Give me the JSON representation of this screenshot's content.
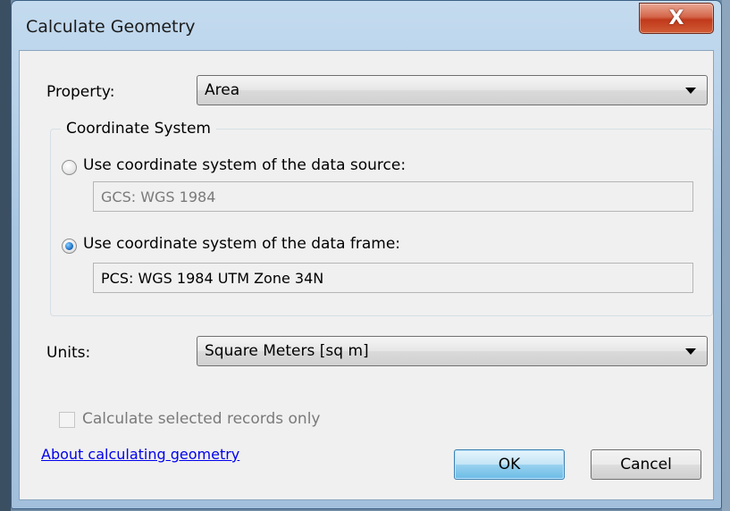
{
  "window": {
    "title": "Calculate Geometry",
    "close_glyph": "X"
  },
  "property": {
    "label": "Property:",
    "selected": "Area"
  },
  "coordinate_system": {
    "group_title": "Coordinate System",
    "source_option": {
      "label": "Use coordinate system of the data source:",
      "selected": false,
      "value": "GCS: WGS 1984"
    },
    "frame_option": {
      "label": "Use coordinate system of the data frame:",
      "selected": true,
      "value": "PCS: WGS 1984 UTM Zone 34N"
    }
  },
  "units": {
    "label": "Units:",
    "selected": "Square Meters [sq m]"
  },
  "selected_only": {
    "label": "Calculate selected records only",
    "checked": false,
    "enabled": false
  },
  "help_link": "About calculating geometry",
  "buttons": {
    "ok": "OK",
    "cancel": "Cancel"
  },
  "colors": {
    "link": "#0000ee",
    "disabled_text": "#7a7a7a",
    "title_bar": "#b8d1ea",
    "close_button": "#c8442a"
  }
}
